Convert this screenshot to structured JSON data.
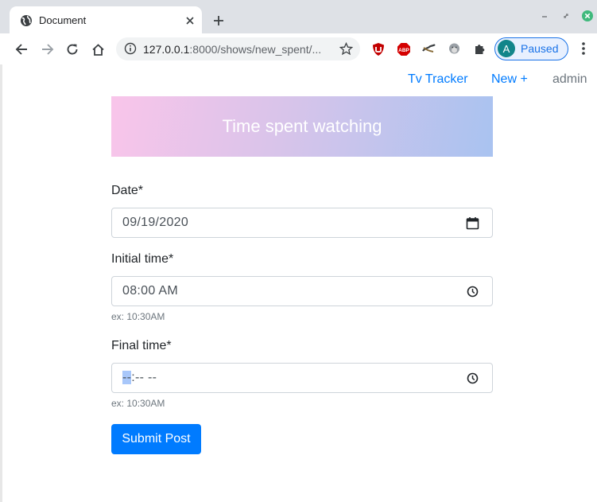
{
  "browser": {
    "tab_title": "Document",
    "url_host": "127.0.0.1",
    "url_rest": ":8000/shows/new_spent/...",
    "profile_initial": "A",
    "profile_status": "Paused",
    "icons": [
      "globe-icon",
      "close-icon",
      "plus-icon",
      "minimize-icon",
      "restore-icon",
      "window-close-icon",
      "back-icon",
      "forward-icon",
      "reload-icon",
      "home-icon",
      "info-icon",
      "star-icon",
      "ublock-icon",
      "adblock-plus-icon",
      "extension-hands-icon",
      "extension-monkey-icon",
      "puzzle-icon",
      "kebab-menu-icon"
    ],
    "colors": {
      "accent": "#1a73e8",
      "avatar": "#12858a",
      "close_green": "#3fb97c"
    }
  },
  "nav": {
    "brand": "Tv Tracker",
    "new": "New +",
    "user": "admin"
  },
  "banner": {
    "title": "Time spent watching",
    "gradient": [
      "#f9c5ea",
      "#a9c3f0"
    ]
  },
  "form": {
    "date": {
      "label": "Date*",
      "value": "09/19/2020",
      "icon": "calendar-icon"
    },
    "initial_time": {
      "label": "Initial time*",
      "value": "08:00 AM",
      "help": "ex: 10:30AM",
      "icon": "clock-icon"
    },
    "final_time": {
      "label": "Final time*",
      "seg_selected": "--",
      "seg_rest": ":-- --",
      "help": "ex: 10:30AM",
      "icon": "clock-icon"
    },
    "submit": "Submit Post"
  },
  "colors": {
    "primary": "#007bff",
    "muted": "#6c757d"
  }
}
